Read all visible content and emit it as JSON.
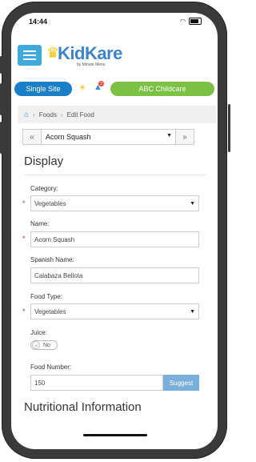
{
  "status_bar": {
    "time": "14:44"
  },
  "header": {
    "logo_text": "KidKare",
    "logo_sub": "by Minute Menu"
  },
  "toolbar": {
    "site_label": "Single Site",
    "notification_count": "3",
    "center_label": "ABC Childcare"
  },
  "breadcrumb": {
    "items": [
      "Foods",
      "Edit Food"
    ]
  },
  "food_nav": {
    "prev": "«",
    "selected": "Acorn Squash",
    "next": "»"
  },
  "display": {
    "title": "Display",
    "category": {
      "label": "Category:",
      "value": "Vegetables"
    },
    "name": {
      "label": "Name:",
      "value": "Acorn Squash"
    },
    "spanish_name": {
      "label": "Spanish Name:",
      "value": "Calabaza Bellota"
    },
    "food_type": {
      "label": "Food Type:",
      "value": "Vegetables"
    },
    "juice": {
      "label": "Juice:",
      "value": "No",
      "knob": "III"
    },
    "food_number": {
      "label": "Food Number:",
      "value": "150",
      "suggest_label": "Suggest"
    }
  },
  "nutrition": {
    "title": "Nutritional Information"
  },
  "required_marker": "*",
  "colors": {
    "accent": "#3fa9dc",
    "site_pill": "#1a7fc6",
    "center_pill": "#7bc144",
    "suggest": "#7aaedb"
  }
}
